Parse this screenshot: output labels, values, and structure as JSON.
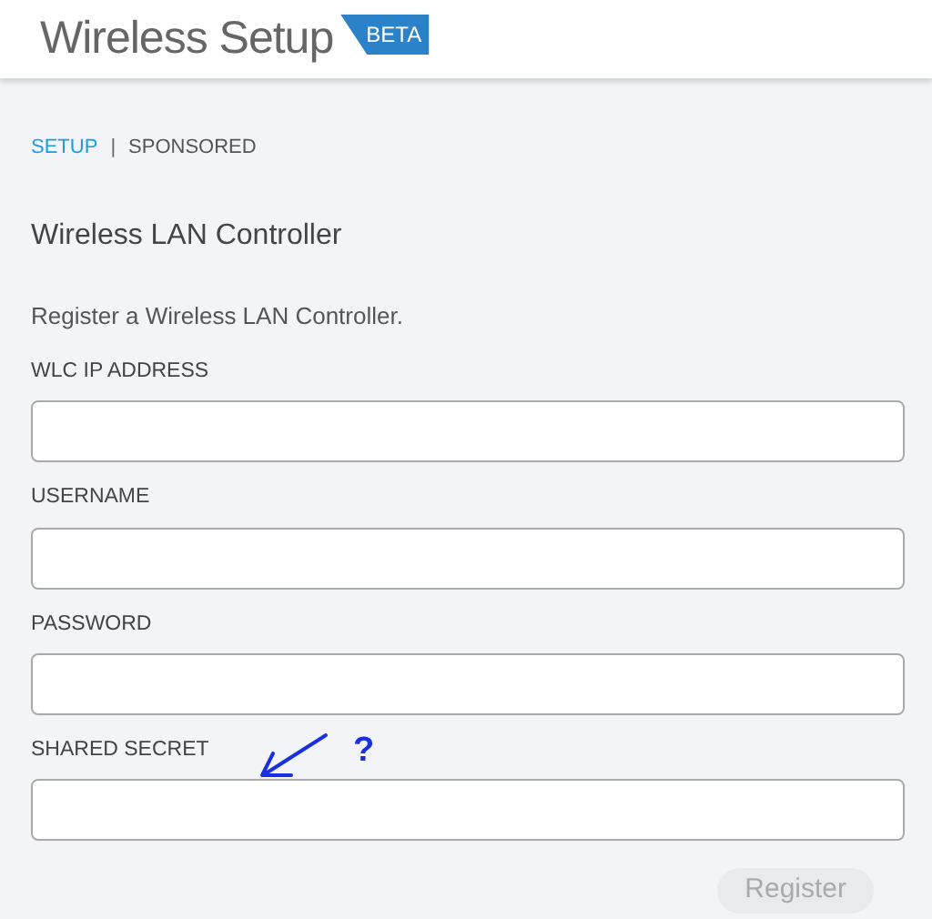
{
  "header": {
    "title": "Wireless Setup",
    "badge": "BETA"
  },
  "tabs": [
    {
      "label": "SETUP",
      "selected": true
    },
    {
      "label": "SPONSORED",
      "selected": false
    }
  ],
  "tab_separator": "|",
  "section_title": "Wireless LAN Controller",
  "description": "Register a Wireless LAN Controller.",
  "fields": [
    {
      "label": "WLC IP ADDRESS"
    },
    {
      "label": "USERNAME"
    },
    {
      "label": "PASSWORD"
    },
    {
      "label": "SHARED SECRET"
    }
  ],
  "annotation": {
    "text": "?"
  },
  "register_button": {
    "label": "Register",
    "disabled": true
  }
}
